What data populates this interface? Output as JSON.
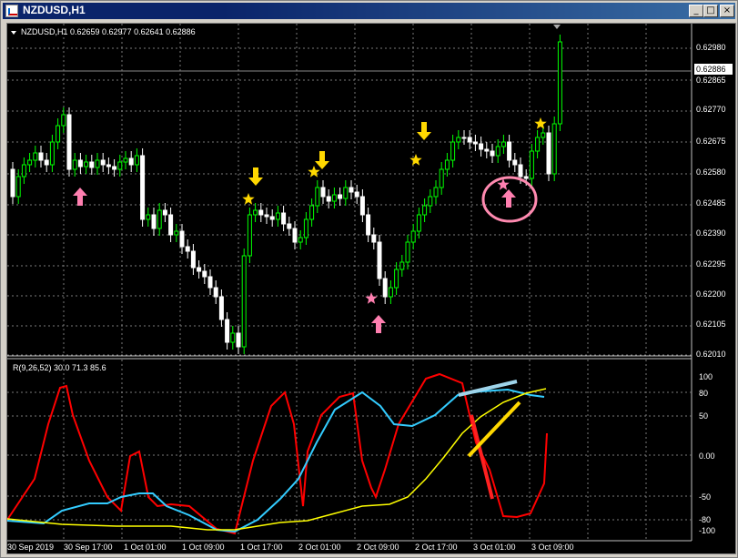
{
  "window": {
    "title": "NZDUSD,H1",
    "buttons": {
      "minimize": "_",
      "maximize": "□",
      "close": "×"
    }
  },
  "main_chart": {
    "symbol_info": "NZDUSD,H1  0.62659 0.62977 0.62641 0.62886",
    "price_labels": [
      "0.62980",
      "0.62886",
      "0.62865",
      "0.62770",
      "0.62675",
      "0.62580",
      "0.62485",
      "0.62390",
      "0.62295",
      "0.62200",
      "0.62105",
      "0.62010"
    ],
    "current_price": "0.62886"
  },
  "indicator": {
    "label": "R(9,26,52) 30.0 71.3 85.6",
    "levels": [
      "100",
      "80",
      "50",
      "0.00",
      "-50",
      "-80",
      "-100"
    ]
  },
  "time_labels": [
    "30 Sep 2019",
    "30 Sep 17:00",
    "1 Oct 01:00",
    "1 Oct 09:00",
    "1 Oct 17:00",
    "2 Oct 01:00",
    "2 Oct 09:00",
    "2 Oct 17:00",
    "3 Oct 01:00",
    "3 Oct 09:00"
  ],
  "colors": {
    "bull": "#00ff00",
    "bear": "#ffffff",
    "grid": "#7a7a7a",
    "red_line": "#ff0000",
    "cyan_line": "#33ccff",
    "yellow_line": "#ffff00",
    "arrow_yellow": "#ffd800",
    "arrow_pink": "#ff7fb0"
  },
  "icons": [
    "app-icon",
    "minimize-icon",
    "maximize-icon",
    "close-icon",
    "up-arrow-icon",
    "down-arrow-icon",
    "star-icon"
  ]
}
